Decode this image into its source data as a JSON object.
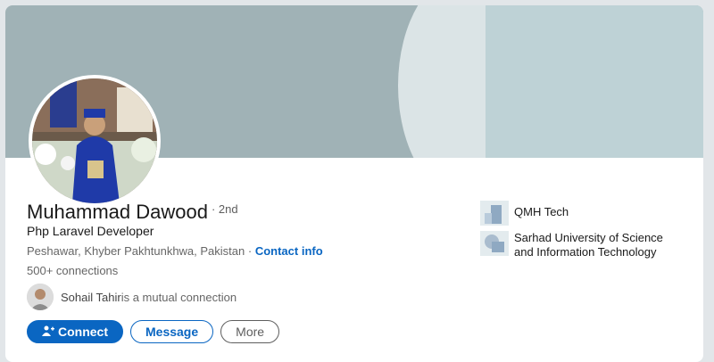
{
  "profile": {
    "name": "Muhammad Dawood",
    "degree": "· 2nd",
    "headline": "Php Laravel Developer",
    "location": "Peshawar, Khyber Pakhtunkhwa, Pakistan",
    "location_separator": " · ",
    "contact_info_label": "Contact info",
    "connections": "500+ connections"
  },
  "mutual": {
    "name": "Sohail Tahir",
    "text": " is a mutual connection"
  },
  "actions": {
    "connect_label": "Connect",
    "message_label": "Message",
    "more_label": "More"
  },
  "orgs": [
    {
      "name": "QMH Tech",
      "icon": "company-logo-icon"
    },
    {
      "name": "Sarhad University of Science and Information Technology",
      "icon": "school-logo-icon"
    }
  ],
  "colors": {
    "accent": "#0a66c2",
    "banner": "#a0b2b6",
    "banner_right": "#bed2d6"
  }
}
